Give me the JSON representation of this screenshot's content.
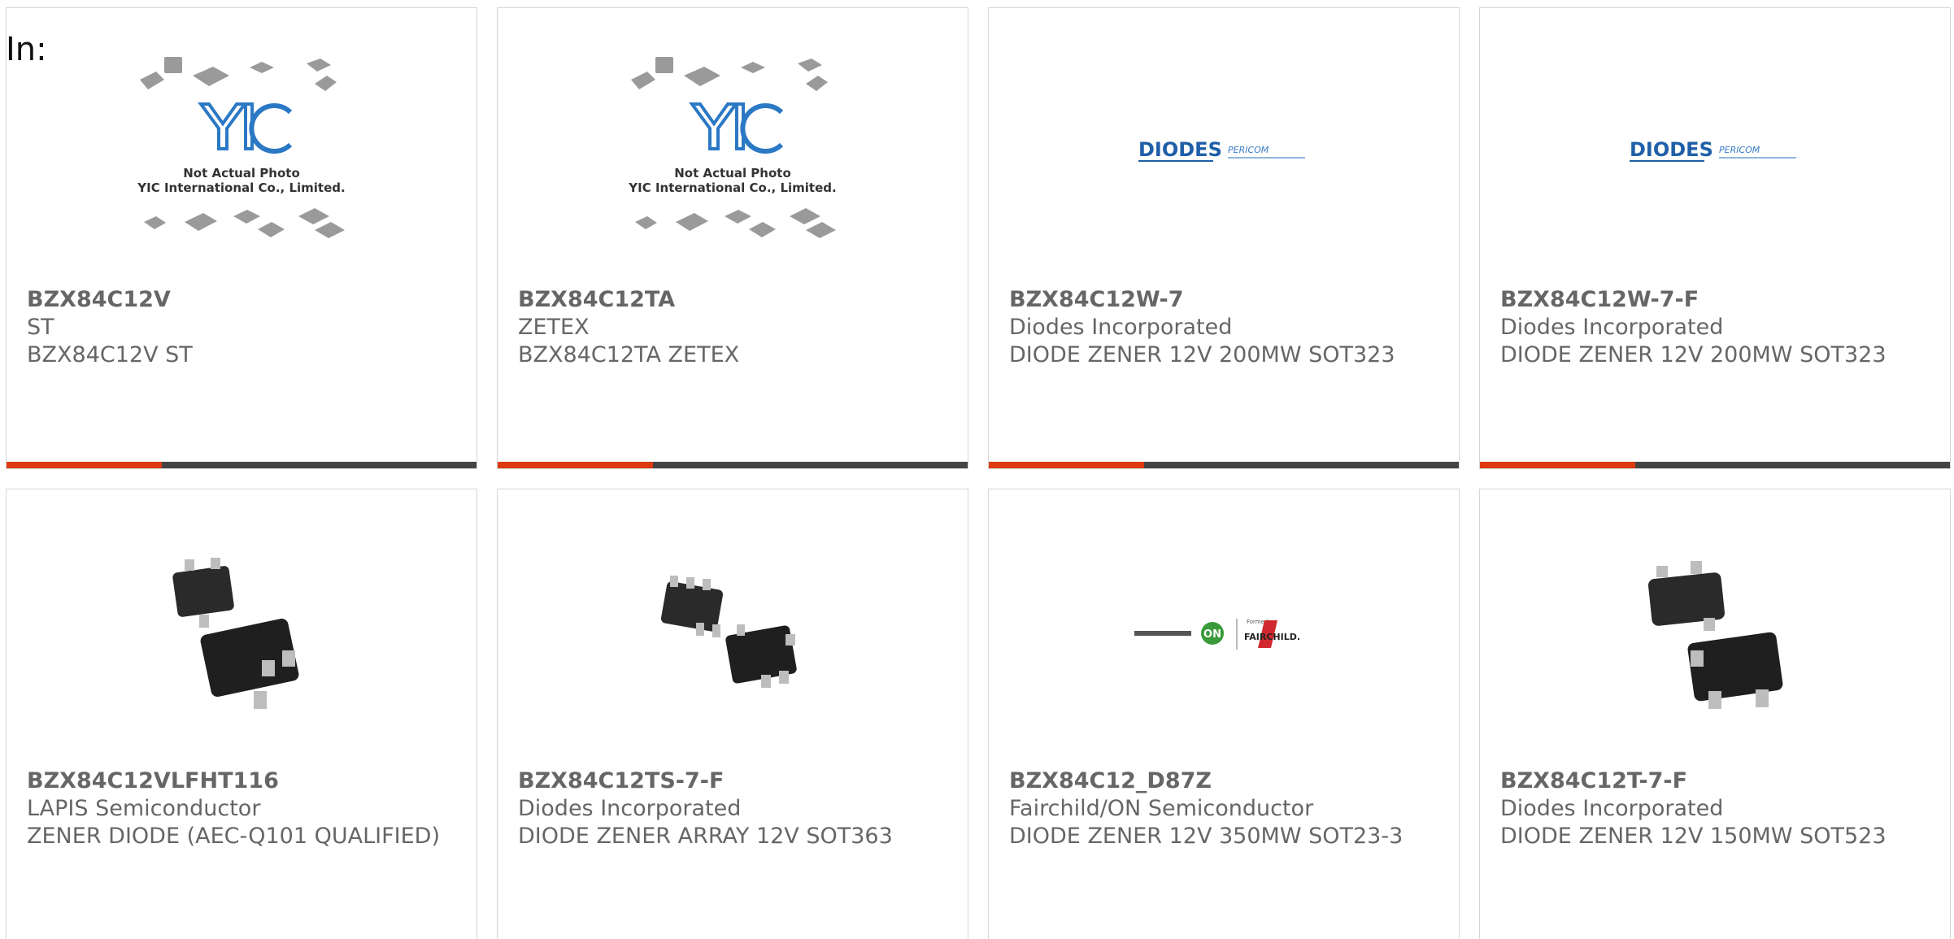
{
  "filter_label": "In:",
  "colors": {
    "progress_fill": "#dd3a12",
    "progress_track": "#444444",
    "text": "#666666",
    "border": "#d6d6d6"
  },
  "products": [
    {
      "part": "BZX84C12V",
      "maker": "ST",
      "desc": "BZX84C12V ST",
      "image_icon": "yic-not-actual-photo-placeholder",
      "image_caption_1": "Not Actual Photo",
      "image_caption_2": "YIC International Co., Limited.",
      "image_logo": "YIC",
      "progress": 0.33
    },
    {
      "part": "BZX84C12TA",
      "maker": "ZETEX",
      "desc": "BZX84C12TA ZETEX",
      "image_icon": "yic-not-actual-photo-placeholder",
      "image_caption_1": "Not Actual Photo",
      "image_caption_2": "YIC International Co., Limited.",
      "image_logo": "YIC",
      "progress": 0.33
    },
    {
      "part": "BZX84C12W-7",
      "maker": "Diodes Incorporated",
      "desc": "DIODE ZENER 12V 200MW SOT323",
      "image_icon": "diodes-pericom-logo",
      "image_logo": "DIODES",
      "image_logo_2": "PERICOM",
      "progress": 0.33
    },
    {
      "part": "BZX84C12W-7-F",
      "maker": "Diodes Incorporated",
      "desc": "DIODE ZENER 12V 200MW SOT323",
      "image_icon": "diodes-pericom-logo",
      "image_logo": "DIODES",
      "image_logo_2": "PERICOM",
      "progress": 0.33
    },
    {
      "part": "BZX84C12VLFHT116",
      "maker": "LAPIS Semiconductor",
      "desc": "ZENER DIODE (AEC-Q101 QUALIFIED)",
      "image_icon": "sot23-chip-photo"
    },
    {
      "part": "BZX84C12TS-7-F",
      "maker": "Diodes Incorporated",
      "desc": "DIODE ZENER ARRAY 12V SOT363",
      "image_icon": "sot363-chip-photo"
    },
    {
      "part": "BZX84C12_D87Z",
      "maker": "Fairchild/ON Semiconductor",
      "desc": "DIODE ZENER 12V 350MW SOT23-3",
      "image_icon": "onsemi-fairchild-logo",
      "image_logo": "ON",
      "image_logo_2": "FAIRCHILD."
    },
    {
      "part": "BZX84C12T-7-F",
      "maker": "Diodes Incorporated",
      "desc": "DIODE ZENER 12V 150MW SOT523",
      "image_icon": "sot523-chip-photo"
    }
  ]
}
